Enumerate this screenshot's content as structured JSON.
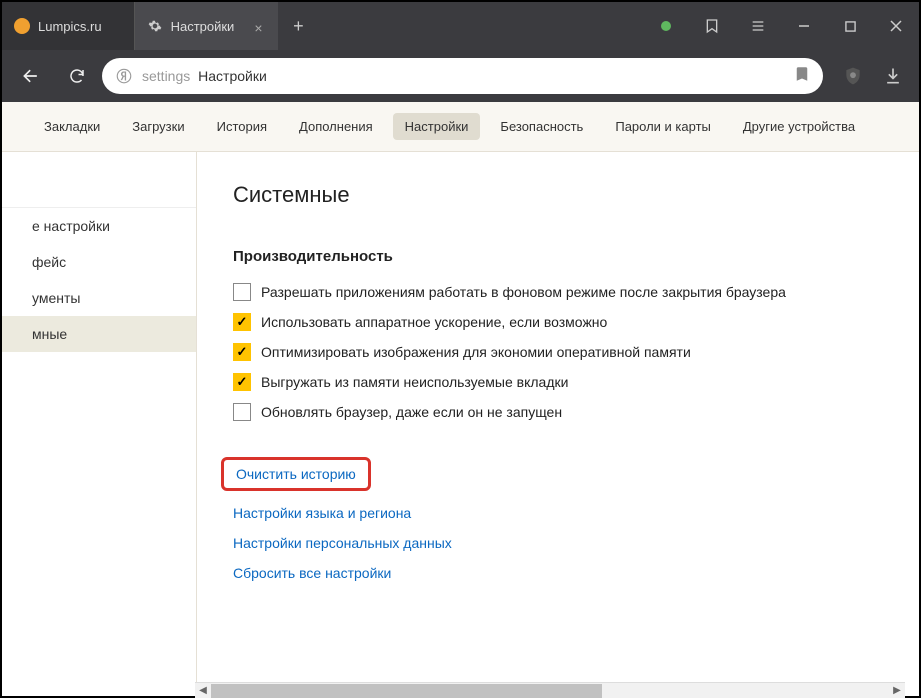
{
  "tabs": [
    {
      "title": "Lumpics.ru",
      "icon_color": "#f0a030"
    },
    {
      "title": "Настройки",
      "icon": "gear"
    }
  ],
  "address": {
    "prefix": "settings",
    "page": "Настройки"
  },
  "subnav": {
    "items": [
      "Закладки",
      "Загрузки",
      "История",
      "Дополнения",
      "Настройки",
      "Безопасность",
      "Пароли и карты",
      "Другие устройства"
    ],
    "active": 4
  },
  "sidebar": {
    "items": [
      "е настройки",
      "фейс",
      "ументы",
      "мные"
    ],
    "active": 3
  },
  "section": {
    "title": "Системные",
    "group_title": "Производительность",
    "checks": [
      {
        "label": "Разрешать приложениям работать в фоновом режиме после закрытия браузера",
        "checked": false
      },
      {
        "label": "Использовать аппаратное ускорение, если возможно",
        "checked": true
      },
      {
        "label": "Оптимизировать изображения для экономии оперативной памяти",
        "checked": true
      },
      {
        "label": "Выгружать из памяти неиспользуемые вкладки",
        "checked": true
      },
      {
        "label": "Обновлять браузер, даже если он не запущен",
        "checked": false
      }
    ],
    "links": [
      {
        "label": "Очистить историю",
        "highlighted": true
      },
      {
        "label": "Настройки языка и региона",
        "highlighted": false
      },
      {
        "label": "Настройки персональных данных",
        "highlighted": false
      },
      {
        "label": "Сбросить все настройки",
        "highlighted": false
      }
    ]
  }
}
